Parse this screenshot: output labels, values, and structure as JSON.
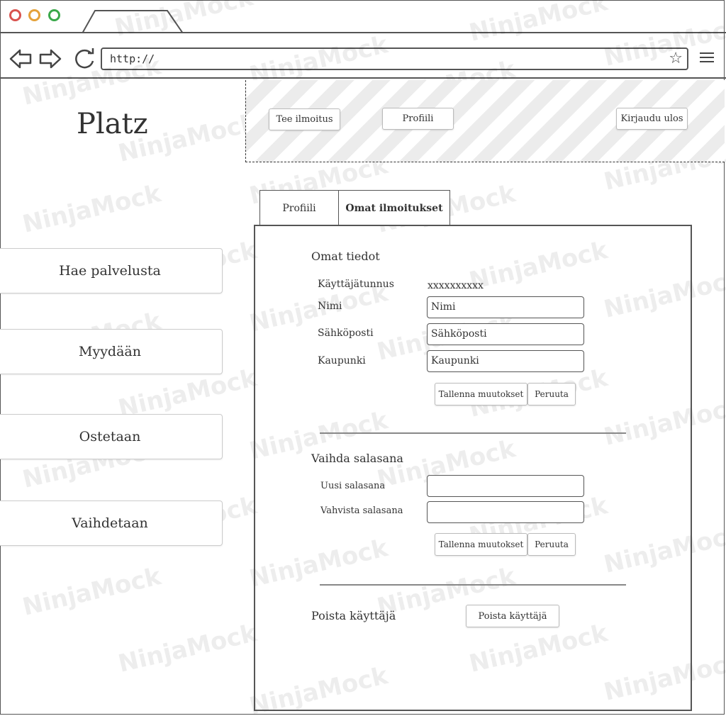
{
  "browser": {
    "url": "http://"
  },
  "app": {
    "logo": "Platz"
  },
  "topbar": {
    "create_listing": "Tee ilmoitus",
    "profile": "Profiili",
    "logout": "Kirjaudu ulos"
  },
  "sidebar": {
    "items": [
      {
        "label": "Hae palvelusta"
      },
      {
        "label": "Myydään"
      },
      {
        "label": "Ostetaan"
      },
      {
        "label": "Vaihdetaan"
      }
    ]
  },
  "tabs": [
    {
      "label": "Profiili"
    },
    {
      "label": "Omat ilmoitukset"
    }
  ],
  "profile": {
    "heading": "Omat tiedot",
    "username_label": "Käyttäjätunnus",
    "username_value": "xxxxxxxxxx",
    "name_label": "Nimi",
    "name_value": "Nimi",
    "email_label": "Sähköposti",
    "email_value": "Sähköposti",
    "city_label": "Kaupunki",
    "city_value": "Kaupunki",
    "save": "Tallenna muutokset",
    "cancel": "Peruuta"
  },
  "password": {
    "heading": "Vaihda salasana",
    "new_label": "Uusi salasana",
    "confirm_label": "Vahvista salasana",
    "save": "Tallenna muutokset",
    "cancel": "Peruuta"
  },
  "delete": {
    "label": "Poista käyttäjä",
    "button": "Poista käyttäjä"
  },
  "watermark": {
    "text": "NinjaMock"
  }
}
